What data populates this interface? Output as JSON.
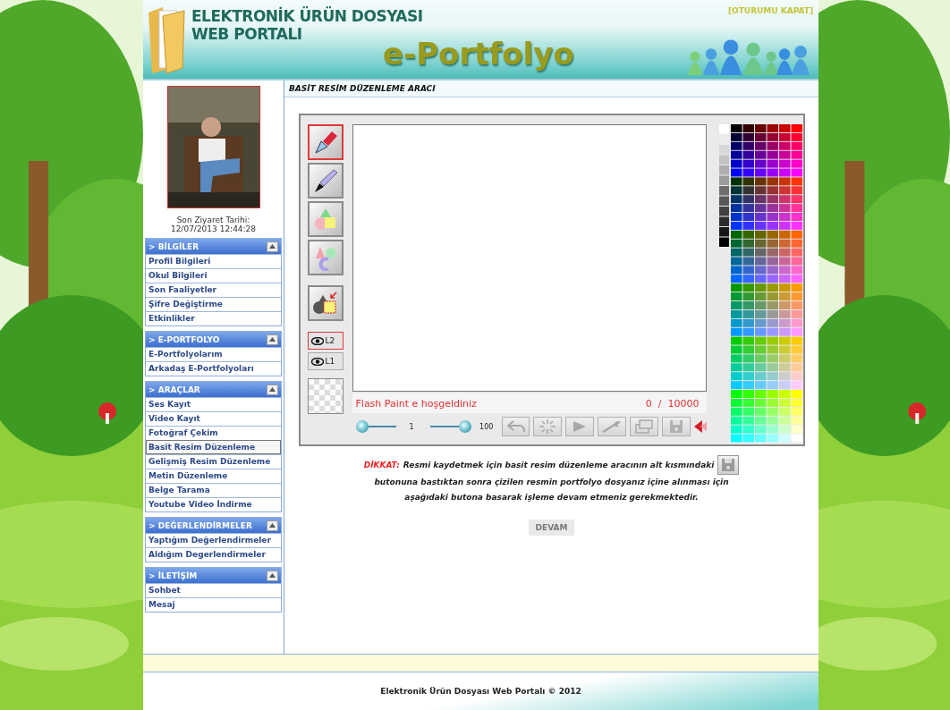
{
  "header": {
    "title_line1": "ELEKTRONİK ÜRÜN DOSYASI",
    "title_line2": "WEB PORTALI",
    "brand": "e-Portfolyo",
    "logout": "[OTURUMU KAPAT]"
  },
  "sidebar": {
    "last_visit_label": "Son Ziyaret Tarihi:",
    "last_visit_date": "12/07/2013 12:44:28",
    "sections": [
      {
        "title": "> BİLGİLER",
        "expanded": true,
        "items": [
          {
            "label": "Profil Bilgileri",
            "selected": false
          },
          {
            "label": "Okul Bilgileri",
            "selected": false
          },
          {
            "label": "Son Faaliyetler",
            "selected": false
          },
          {
            "label": "Şifre Değiştirme",
            "selected": false
          },
          {
            "label": "Etkinlikler",
            "selected": false
          }
        ]
      },
      {
        "title": "> E-PORTFOLYO",
        "expanded": true,
        "items": [
          {
            "label": "E-Portfolyolarım",
            "selected": false
          },
          {
            "label": "Arkadaş E-Portfolyoları",
            "selected": false
          }
        ]
      },
      {
        "title": "> ARAÇLAR",
        "expanded": true,
        "items": [
          {
            "label": "Ses Kayıt",
            "selected": false
          },
          {
            "label": "Video Kayıt",
            "selected": false
          },
          {
            "label": "Fotoğraf Çekim",
            "selected": false
          },
          {
            "label": "Basit Resim Düzenleme",
            "selected": true
          },
          {
            "label": "Gelişmiş Resim Düzenleme",
            "selected": false
          },
          {
            "label": "Metin Düzenleme",
            "selected": false
          },
          {
            "label": "Belge Tarama",
            "selected": false
          },
          {
            "label": "Youtube Video İndirme",
            "selected": false
          }
        ]
      },
      {
        "title": "> DEĞERLENDİRMELER",
        "expanded": true,
        "items": [
          {
            "label": "Yaptığım Değerlendirmeler",
            "selected": false
          },
          {
            "label": "Aldığım Degerlendirmeler",
            "selected": false
          }
        ]
      },
      {
        "title": "> İLETİŞİM",
        "expanded": true,
        "items": [
          {
            "label": "Sohbet",
            "selected": false
          },
          {
            "label": "Mesaj",
            "selected": false
          }
        ]
      }
    ]
  },
  "page_title": "BASİT RESİM DÜZENLEME ARACI",
  "paint": {
    "tools": [
      {
        "kind": "pen",
        "selected": true
      },
      {
        "kind": "brush",
        "selected": false
      },
      {
        "kind": "shapes",
        "selected": false
      },
      {
        "kind": "text",
        "selected": false
      },
      {
        "kind": "transform",
        "selected": false
      }
    ],
    "layers": [
      {
        "label": "L2",
        "selected": true
      },
      {
        "label": "L1",
        "selected": false
      }
    ],
    "status": "Flash Paint e hoşgeldiniz",
    "counter": "0  /  10000",
    "sliders": [
      {
        "value": "1",
        "level": 0
      },
      {
        "value": "100",
        "level": 1
      }
    ],
    "actions": [
      {
        "kind": "undo",
        "disabled": true
      },
      {
        "kind": "clear",
        "disabled": true
      },
      {
        "kind": "play",
        "disabled": true
      },
      {
        "kind": "wrench",
        "disabled": true
      },
      {
        "kind": "print",
        "disabled": true
      },
      {
        "kind": "save",
        "disabled": true
      }
    ]
  },
  "notice": {
    "label": "DİKKAT:",
    "line1": "Resmi kaydetmek için basit resim düzenleme aracının alt kısmındaki",
    "lines": [
      "butonuna bastıktan sonra çizilen resmin portfolyo dosyanız içine alınması için",
      "aşağıdaki butona basarak işleme devam etmeniz gerekmektedir."
    ]
  },
  "continue_button": "DEVAM",
  "footer": "Elektronik Ürün Dosyası Web Portalı © 2012"
}
